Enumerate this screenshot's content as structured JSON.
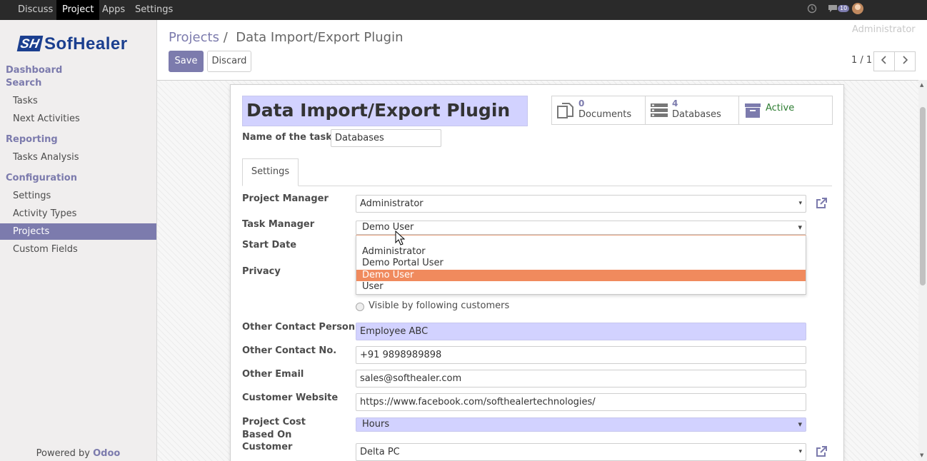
{
  "topbar": {
    "menus": [
      "Discuss",
      "Project",
      "Apps",
      "Settings"
    ],
    "active_menu": "Project",
    "message_count": "10",
    "user": "Administrator"
  },
  "sidebar": {
    "logo_text": "SofHealer",
    "logo_mark": "SH",
    "dashboard": "Dashboard",
    "search": "Search",
    "search_items": [
      "Tasks",
      "Next Activities"
    ],
    "reporting": "Reporting",
    "reporting_items": [
      "Tasks Analysis"
    ],
    "configuration": "Configuration",
    "configuration_items": [
      "Settings",
      "Activity Types",
      "Projects",
      "Custom Fields"
    ],
    "active_item": "Projects",
    "powered_prefix": "Powered by",
    "powered_brand": "Odoo"
  },
  "control_panel": {
    "breadcrumb_parent": "Projects",
    "breadcrumb_sep": "/",
    "breadcrumb_current": "Data Import/Export Plugin",
    "save_label": "Save",
    "discard_label": "Discard",
    "pager": "1 / 1"
  },
  "form": {
    "title": "Data Import/Export Plugin",
    "tasks_name_label": "Name of the tasks :",
    "tasks_name_value": "Databases",
    "stat_buttons": [
      {
        "count": "0",
        "label": "Documents",
        "icon": "documents-icon"
      },
      {
        "count": "4",
        "label": "Databases",
        "icon": "database-icon"
      },
      {
        "count": "",
        "label": "Active",
        "icon": "archive-icon"
      }
    ],
    "tab_label": "Settings",
    "fields": {
      "project_manager": {
        "label": "Project Manager",
        "value": "Administrator"
      },
      "task_manager": {
        "label": "Task Manager",
        "value": "Demo User"
      },
      "start_date": {
        "label": "Start Date"
      },
      "privacy": {
        "label": "Privacy",
        "visible_option": "Visible by following customers"
      },
      "other_contact_person": {
        "label": "Other Contact Person",
        "value": "Employee ABC"
      },
      "other_contact_no": {
        "label": "Other Contact No.",
        "value": "+91 9898989898"
      },
      "other_email": {
        "label": "Other Email",
        "value": "sales@softhealer.com"
      },
      "customer_website": {
        "label": "Customer Website",
        "value": "https://www.facebook.com/softhealertechnologies/"
      },
      "project_cost_based_on": {
        "label": "Project Cost Based On",
        "value": "Hours"
      },
      "customer": {
        "label": "Customer",
        "value": "Delta PC"
      }
    },
    "dropdown_options": [
      "Administrator",
      "Demo Portal User",
      "Demo User",
      "User"
    ],
    "dropdown_selected": "Demo User"
  },
  "colors": {
    "accent": "#7c7bad",
    "required_field": "#d2d2ff",
    "dropdown_highlight": "#f08a5d",
    "active_state": "#2e7d32"
  }
}
